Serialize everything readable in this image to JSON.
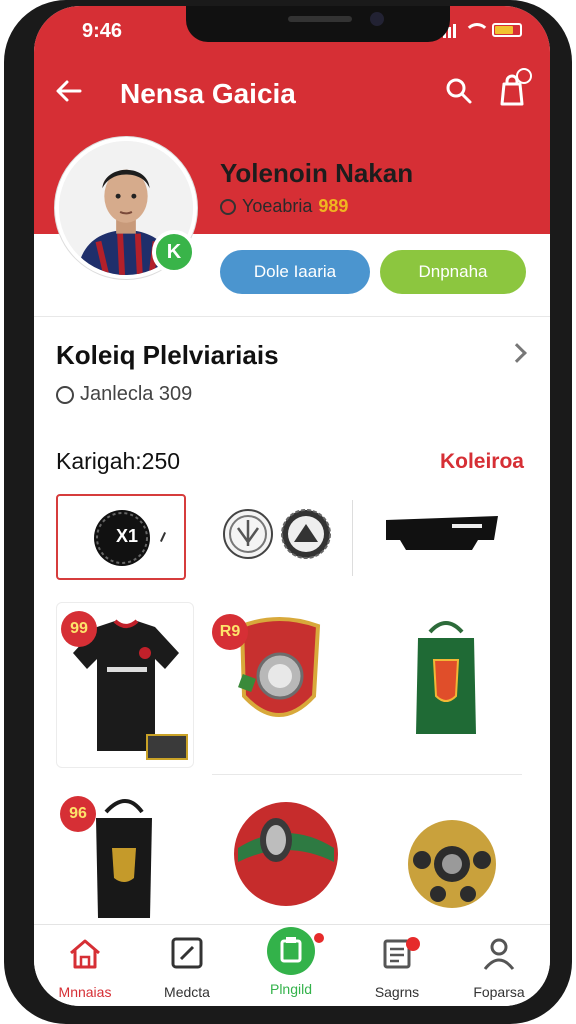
{
  "status": {
    "time": "9:46"
  },
  "appbar": {
    "title": "Nensa Gaicia"
  },
  "profile": {
    "name": "Yolenoin Nakan",
    "subtitle_prefix": "Yoeabria",
    "points": "989",
    "button_primary": "Dole Iaaria",
    "button_secondary": "Dnpnaha"
  },
  "collection": {
    "title": "Koleiq Plelviariais",
    "subtitle": "Janlecla 309"
  },
  "category": {
    "label": "Karigah:250",
    "link": "Koleiroa"
  },
  "items": {
    "selected_label": "X1",
    "badge_1": "99",
    "badge_2": "R9",
    "badge_3": "96"
  },
  "nav": [
    {
      "label": "Mnnaias",
      "icon": "home-icon"
    },
    {
      "label": "Medcta",
      "icon": "edit-icon"
    },
    {
      "label": "Plngild",
      "icon": "clipboard-icon"
    },
    {
      "label": "Sagrns",
      "icon": "document-icon"
    },
    {
      "label": "Foparsa",
      "icon": "user-icon"
    }
  ],
  "colors": {
    "brand_red": "#d62f35",
    "accent_blue": "#4b95cf",
    "accent_green": "#8cc63f",
    "points_gold": "#f0b520",
    "nav_green": "#33b24a"
  }
}
